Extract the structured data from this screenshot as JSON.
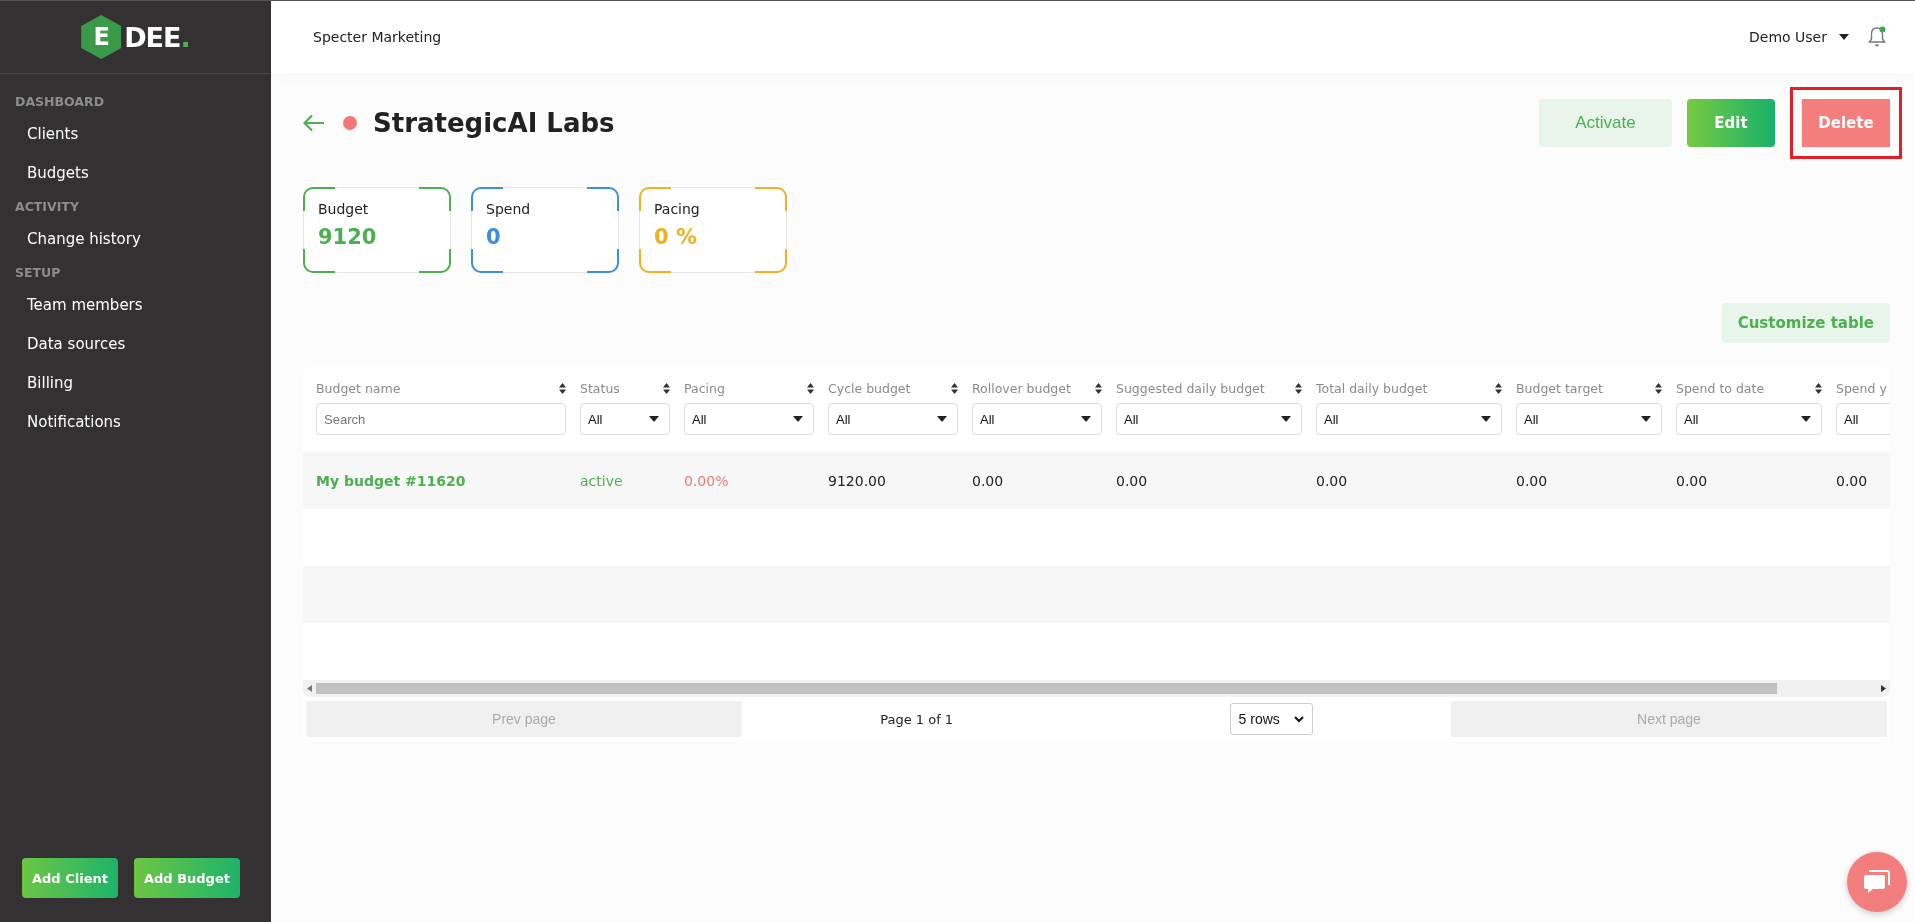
{
  "sidebar": {
    "logo": {
      "mark": "E",
      "word": "DEE",
      "dot": "."
    },
    "sections": [
      {
        "title": "DASHBOARD",
        "items": [
          {
            "label": "Clients"
          },
          {
            "label": "Budgets"
          }
        ]
      },
      {
        "title": "ACTIVITY",
        "items": [
          {
            "label": "Change history"
          }
        ]
      },
      {
        "title": "SETUP",
        "items": [
          {
            "label": "Team members"
          },
          {
            "label": "Data sources"
          },
          {
            "label": "Billing"
          },
          {
            "label": "Notifications"
          }
        ]
      }
    ],
    "buttons": [
      "Add Client",
      "Add Budget"
    ]
  },
  "header": {
    "company": "Specter Marketing",
    "user": "Demo User",
    "has_notification": true
  },
  "client": {
    "active": false,
    "name": "StrategicAI Labs",
    "actions": [
      {
        "label": "Activate",
        "kind": "soft",
        "highlighted": false
      },
      {
        "label": "Edit",
        "kind": "primary",
        "highlighted": false
      },
      {
        "label": "Delete",
        "kind": "danger",
        "highlighted": true
      }
    ]
  },
  "stats": [
    {
      "label": "Budget",
      "value": "9120",
      "color": "#4caf50"
    },
    {
      "label": "Spend",
      "value": "0",
      "color": "#3b8ee8"
    },
    {
      "label": "Pacing",
      "value": "0 %",
      "color": "#f0b020"
    }
  ],
  "customize_button": "Customize table",
  "table": {
    "columns": [
      {
        "label": "Budget name",
        "filter": {
          "kind": "search",
          "placeholder": "Search"
        },
        "kind": "link"
      },
      {
        "label": "Status",
        "filter": {
          "kind": "select",
          "value": "All"
        },
        "kind": "status"
      },
      {
        "label": "Pacing",
        "filter": {
          "kind": "select",
          "value": "All"
        },
        "kind": "alert"
      },
      {
        "label": "Cycle budget",
        "filter": {
          "kind": "select",
          "value": "All"
        },
        "kind": "plain"
      },
      {
        "label": "Rollover budget",
        "filter": {
          "kind": "select",
          "value": "All"
        },
        "kind": "plain"
      },
      {
        "label": "Suggested daily budget",
        "filter": {
          "kind": "select",
          "value": "All"
        },
        "kind": "plain"
      },
      {
        "label": "Total daily budget",
        "filter": {
          "kind": "select",
          "value": "All"
        },
        "kind": "plain"
      },
      {
        "label": "Budget target",
        "filter": {
          "kind": "select",
          "value": "All"
        },
        "kind": "plain"
      },
      {
        "label": "Spend to date",
        "filter": {
          "kind": "select",
          "value": "All"
        },
        "kind": "plain"
      },
      {
        "label": "Spend y",
        "filter": {
          "kind": "select",
          "value": "All"
        },
        "kind": "plain"
      }
    ],
    "rows": [
      [
        "My budget #11620",
        "active",
        "0.00%",
        "9120.00",
        "0.00",
        "0.00",
        "0.00",
        "0.00",
        "0.00",
        "0.00"
      ]
    ]
  },
  "pagination": {
    "prev": {
      "label": "Prev page",
      "disabled": true
    },
    "page": "Page 1 of 1",
    "rows_select": "5 rows",
    "next": {
      "label": "Next page",
      "disabled": true
    }
  }
}
